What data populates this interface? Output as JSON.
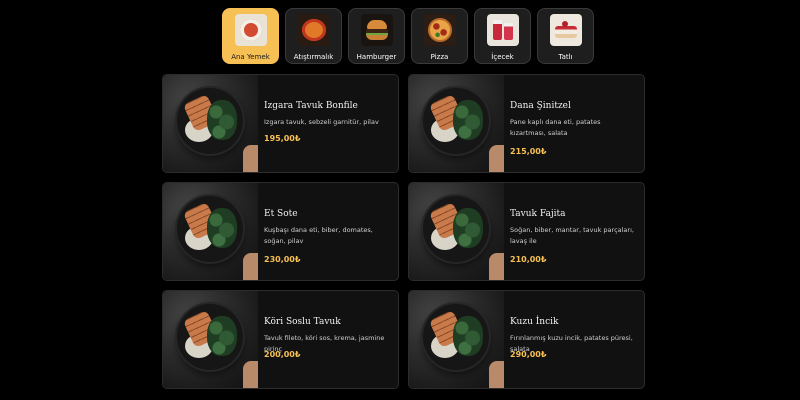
{
  "categories": [
    {
      "label": "Ana Yemek",
      "icon": "main-dish-icon",
      "active": true
    },
    {
      "label": "Atıştırmalık",
      "icon": "snack-icon",
      "active": false
    },
    {
      "label": "Hamburger",
      "icon": "hamburger-icon",
      "active": false
    },
    {
      "label": "Pizza",
      "icon": "pizza-icon",
      "active": false
    },
    {
      "label": "İçecek",
      "icon": "drink-icon",
      "active": false
    },
    {
      "label": "Tatlı",
      "icon": "dessert-icon",
      "active": false
    }
  ],
  "menu_items": [
    {
      "name": "Izgara Tavuk Bonfile",
      "description": "Izgara tavuk, sebzeli garnitür, pilav",
      "price": "195,00₺"
    },
    {
      "name": "Dana Şinitzel",
      "description": "Pane kaplı dana eti, patates kızartması, salata",
      "price": "215,00₺"
    },
    {
      "name": "Et Sote",
      "description": "Kuşbaşı dana eti, biber, domates, soğan, pilav",
      "price": "230,00₺"
    },
    {
      "name": "Tavuk Fajita",
      "description": "Soğan, biber, mantar, tavuk parçaları, lavaş ile",
      "price": "210,00₺"
    },
    {
      "name": "Köri Soslu Tavuk",
      "description": "Tavuk fileto, köri sos, krema, jasmine pirinç",
      "price": "200,00₺"
    },
    {
      "name": "Kuzu İncik",
      "description": "Fırınlanmış kuzu incik, patates püresi, salata",
      "price": "290,00₺"
    }
  ],
  "colors": {
    "accent": "#f6c055",
    "background": "#000000",
    "card": "#111111"
  }
}
